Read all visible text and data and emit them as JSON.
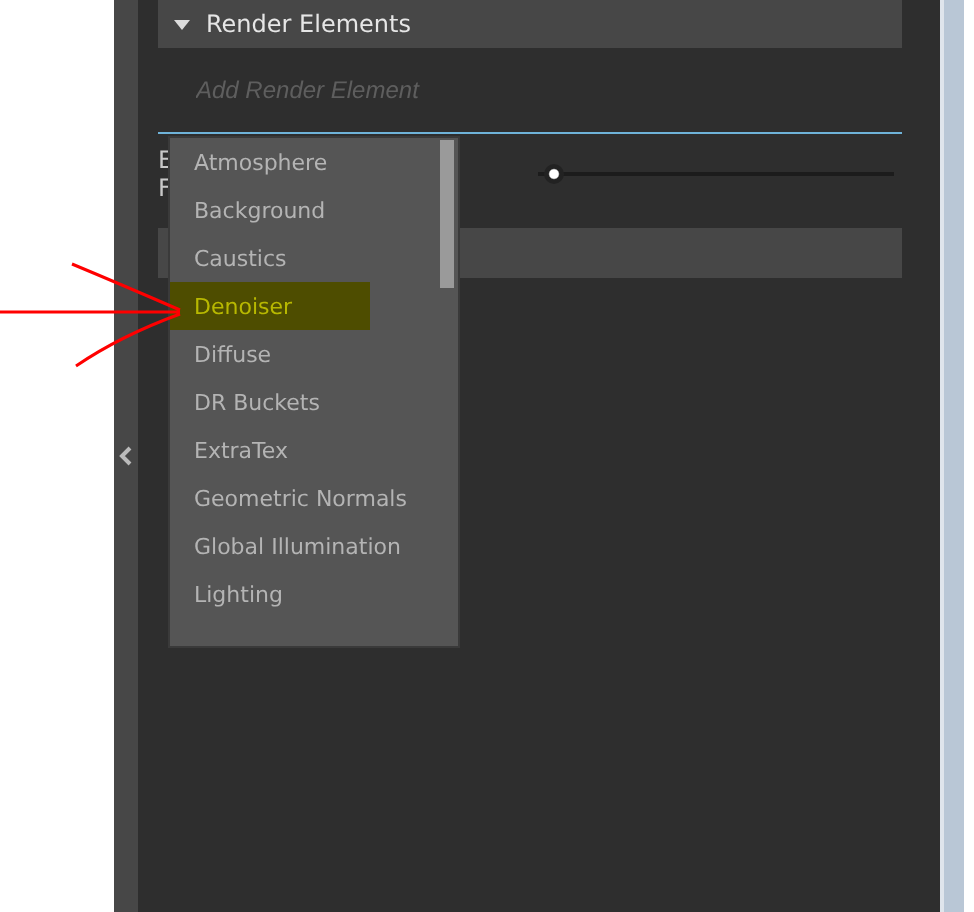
{
  "section": {
    "title": "Render Elements",
    "expanded": true
  },
  "add_field": {
    "placeholder": "Add Render Element"
  },
  "row_labels": [
    "E",
    "F"
  ],
  "slider": {
    "level": 0.03
  },
  "dropdown": {
    "items": [
      {
        "label": "Atmosphere",
        "highlighted": false
      },
      {
        "label": "Background",
        "highlighted": false
      },
      {
        "label": "Caustics",
        "highlighted": false
      },
      {
        "label": "Denoiser",
        "highlighted": true
      },
      {
        "label": "Diffuse",
        "highlighted": false
      },
      {
        "label": "DR Buckets",
        "highlighted": false
      },
      {
        "label": "ExtraTex",
        "highlighted": false
      },
      {
        "label": "Geometric Normals",
        "highlighted": false
      },
      {
        "label": "Global Illumination",
        "highlighted": false
      },
      {
        "label": "Lighting",
        "highlighted": false
      }
    ]
  }
}
